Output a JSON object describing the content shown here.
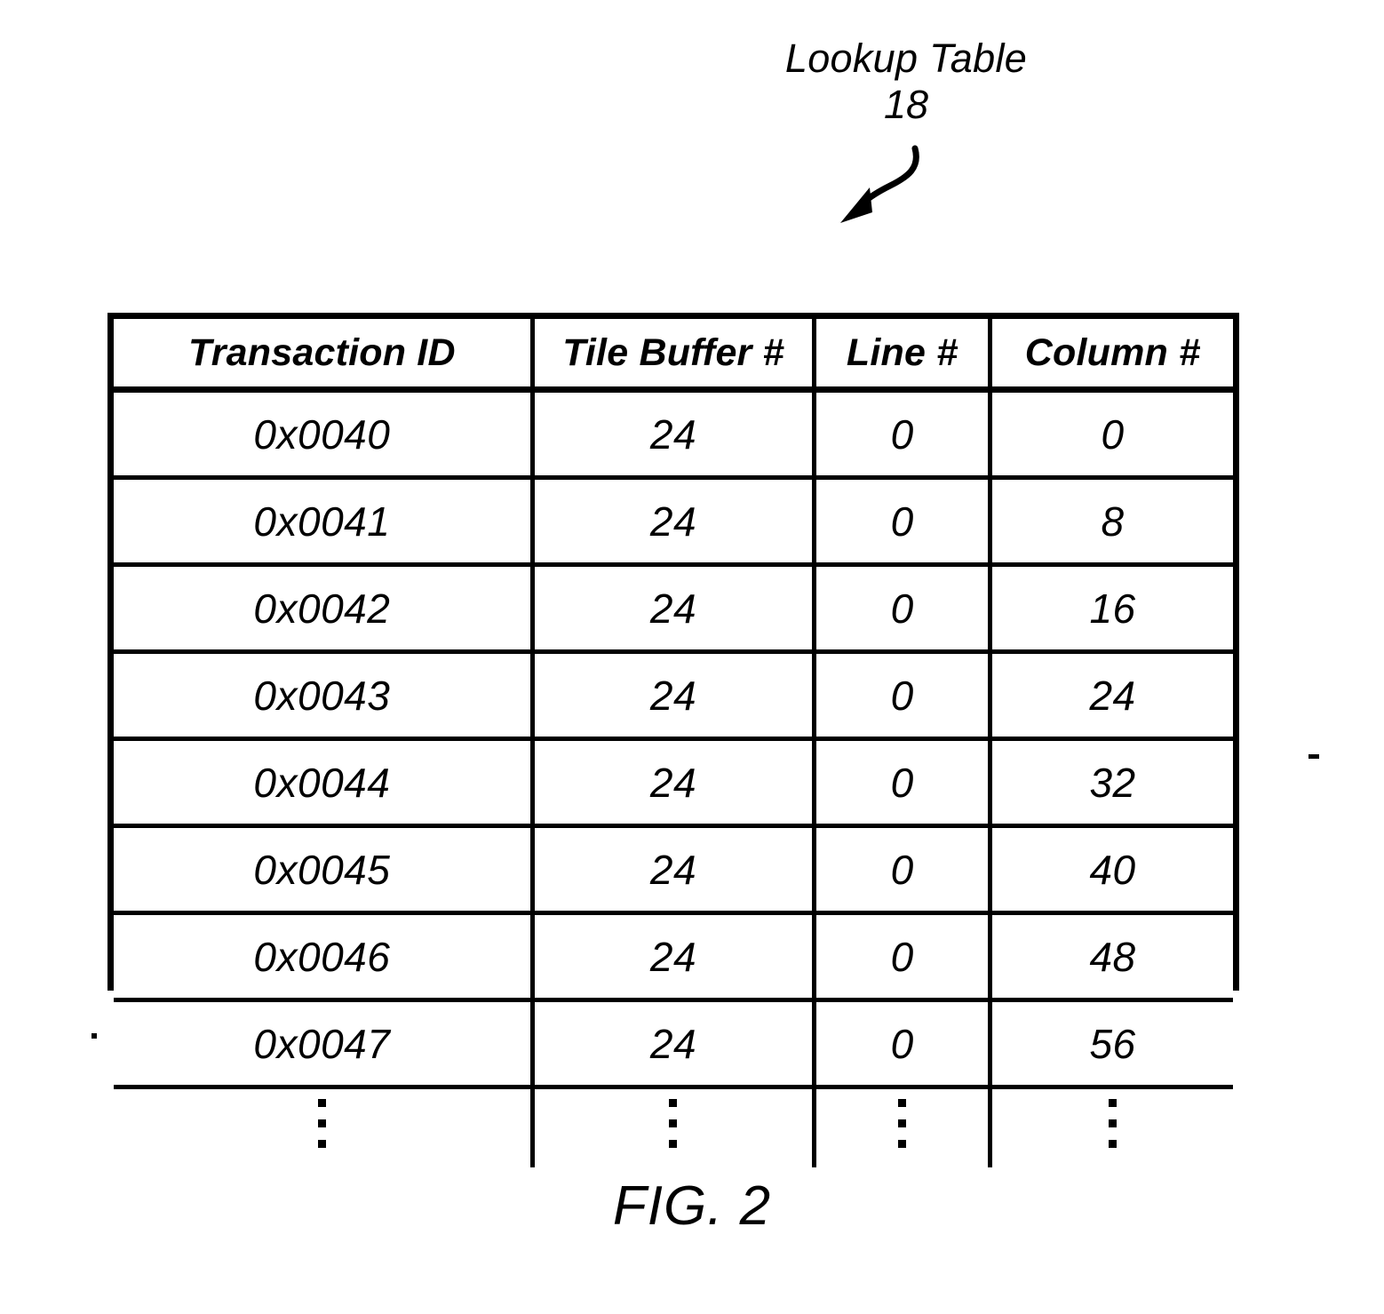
{
  "figure": {
    "caption": "FIG. 2",
    "callout_title": "Lookup Table",
    "callout_reference": "18",
    "arrow_icon": "curved-arrow-down-left-icon",
    "ink_color": "#000000",
    "background_color": "#ffffff"
  },
  "chart_data": {
    "type": "table",
    "title": "Lookup Table",
    "reference_numeral": "18",
    "columns": [
      "Transaction ID",
      "Tile Buffer #",
      "Line #",
      "Column #"
    ],
    "rows": [
      [
        "0x0040",
        "24",
        "0",
        "0"
      ],
      [
        "0x0041",
        "24",
        "0",
        "8"
      ],
      [
        "0x0042",
        "24",
        "0",
        "16"
      ],
      [
        "0x0043",
        "24",
        "0",
        "24"
      ],
      [
        "0x0044",
        "24",
        "0",
        "32"
      ],
      [
        "0x0045",
        "24",
        "0",
        "40"
      ],
      [
        "0x0046",
        "24",
        "0",
        "48"
      ],
      [
        "0x0047",
        "24",
        "0",
        "56"
      ]
    ],
    "continuation_row": [
      "⋮",
      "⋮",
      "⋮",
      "⋮"
    ],
    "continuation_marker": "vertical-ellipsis",
    "notes": "Patent figure: lookup table mapping transaction IDs to tile buffer, line and column numbers"
  }
}
